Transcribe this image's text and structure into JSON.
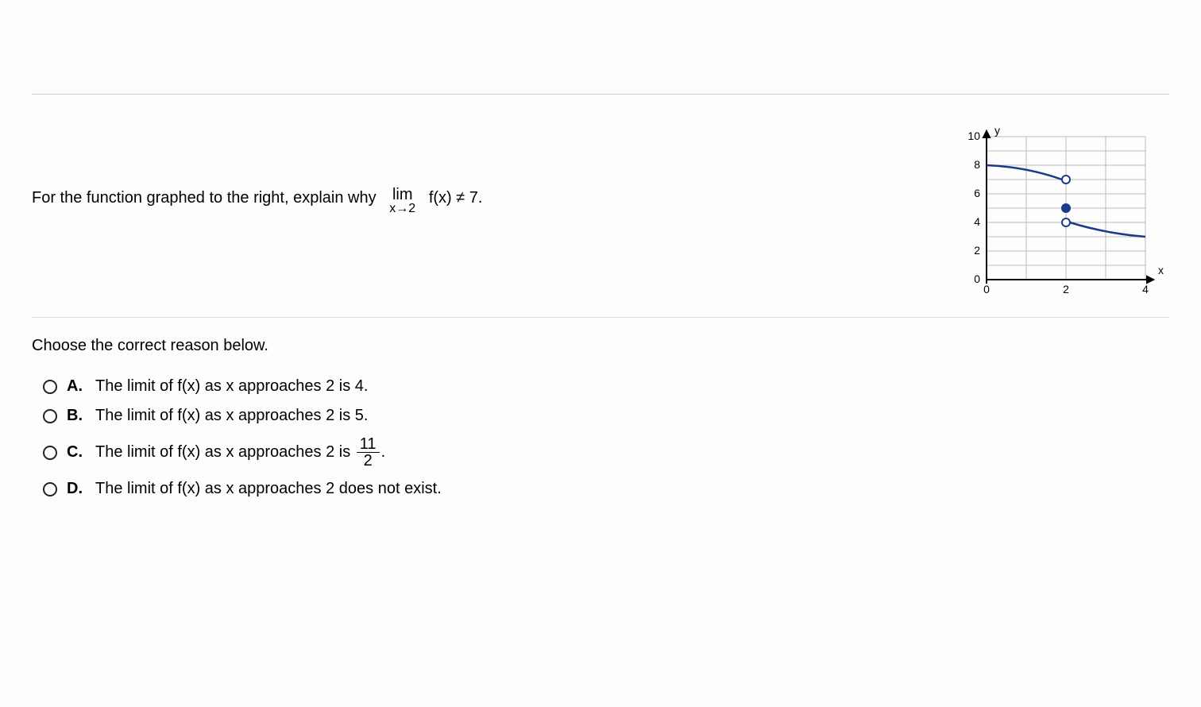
{
  "question": {
    "prefix": "For the function graphed to the right, explain why",
    "lim_word": "lim",
    "lim_sub": "x→2",
    "after_lim": "f(x) ≠ 7.",
    "choose_text": "Choose the correct reason below."
  },
  "options": {
    "A": {
      "label": "A.",
      "text": "The limit of f(x) as x approaches 2 is 4."
    },
    "B": {
      "label": "B.",
      "text": "The limit of f(x) as x approaches 2 is 5."
    },
    "C": {
      "label": "C.",
      "prefix": "The limit of f(x) as x approaches 2 is ",
      "frac_num": "11",
      "frac_den": "2",
      "suffix": "."
    },
    "D": {
      "label": "D.",
      "text": "The limit of f(x) as x approaches 2 does not exist."
    }
  },
  "graph": {
    "y_label": "y",
    "x_label": "x",
    "y_ticks": [
      "0",
      "2",
      "4",
      "6",
      "8",
      "10"
    ],
    "x_ticks": [
      "0",
      "2",
      "4"
    ]
  },
  "chart_data": {
    "type": "line",
    "title": "",
    "xlabel": "x",
    "ylabel": "y",
    "xlim": [
      0,
      4
    ],
    "ylim": [
      0,
      10
    ],
    "series": [
      {
        "name": "left-branch",
        "x": [
          0,
          2
        ],
        "y": [
          8,
          7
        ],
        "open_endpoint_at": [
          2,
          7
        ]
      },
      {
        "name": "right-branch",
        "x": [
          2,
          4
        ],
        "y": [
          4,
          3
        ],
        "open_endpoint_at": [
          2,
          4
        ]
      }
    ],
    "points": [
      {
        "x": 2,
        "y": 5,
        "filled": true,
        "note": "f(2)=5"
      }
    ]
  }
}
